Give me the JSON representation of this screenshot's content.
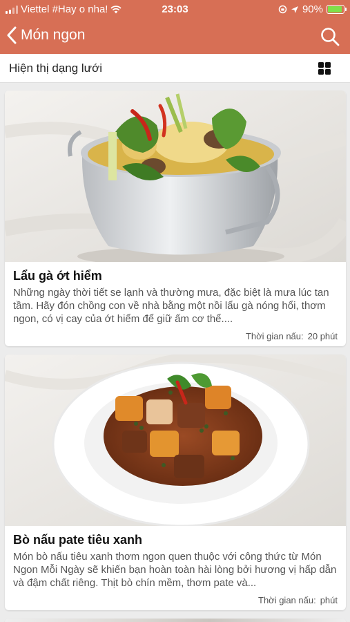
{
  "status_bar": {
    "carrier": "Viettel #Hay o nha!",
    "time": "23:03",
    "battery": "90%",
    "battery_level": 0.9
  },
  "nav": {
    "title": "Món ngon",
    "back_icon": "chevron-left-icon",
    "search_icon": "search-icon"
  },
  "view_toggle": {
    "label": "Hiện thị dạng lưới",
    "icon": "grid-icon"
  },
  "recipes": [
    {
      "title": "Lẩu gà ớt hiểm",
      "description": "Những ngày thời tiết se lạnh và thường mưa, đặc biệt là mưa lúc tan tầm. Hãy đón chồng con về nhà bằng một nồi lẩu gà nóng hổi, thơm ngon, có vị cay của ớt hiểm để giữ ấm cơ thể....",
      "time_label": "Thời gian nấu:",
      "time_value": "20 phút"
    },
    {
      "title": "Bò nấu pate tiêu xanh",
      "description": "Món bò nấu tiêu xanh thơm ngon quen thuộc với công thức từ Món Ngon Mỗi Ngày sẽ khiến bạn hoàn toàn hài lòng bởi hương vị hấp dẫn và đậm chất riêng. Thịt bò chín mềm, thơm pate và...",
      "time_label": "Thời gian nấu:",
      "time_value": "phút"
    }
  ],
  "colors": {
    "header": "#d76f55",
    "background": "#ececec"
  }
}
